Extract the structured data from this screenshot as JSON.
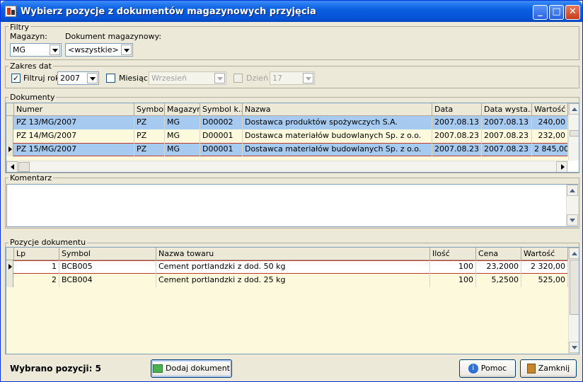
{
  "window": {
    "title": "Wybierz pozycje z dokumentów magazynowych przyjęcia"
  },
  "filters": {
    "group_label": "Filtry",
    "warehouse_label": "Magazyn:",
    "warehouse_value": "MG",
    "doc_label": "Dokument magazynowy:",
    "doc_value": "<wszystkie>"
  },
  "dates": {
    "group_label": "Zakres dat",
    "year_label": "Filtruj rok",
    "year_checked": "✓",
    "year_value": "2007",
    "month_label": "Miesiąc",
    "month_value": "Wrzesień",
    "day_label": "Dzień",
    "day_value": "17"
  },
  "documents": {
    "group_label": "Dokumenty",
    "columns": [
      "Numer",
      "Symbol",
      "Magazyn",
      "Symbol k...",
      "Nazwa",
      "Data",
      "Data wysta...",
      "Wartość"
    ],
    "rows": [
      [
        "PZ  13/MG/2007",
        "PZ",
        "MG",
        "D00002",
        "Dostawca produktów spożywczych S.A.",
        "2007.08.13",
        "2007.08.13",
        "240,00"
      ],
      [
        "PZ  14/MG/2007",
        "PZ",
        "MG",
        "D00001",
        "Dostawca materiałów budowlanych Sp. z o.o.",
        "2007.08.23",
        "2007.08.23",
        "232,00"
      ],
      [
        "PZ  15/MG/2007",
        "PZ",
        "MG",
        "D00001",
        "Dostawca materiałów budowlanych Sp. z o.o.",
        "2007.08.23",
        "2007.08.23",
        "2 845,00"
      ]
    ]
  },
  "comment": {
    "group_label": "Komentarz"
  },
  "positions": {
    "group_label": "Pozycje dokumentu",
    "columns": [
      "Lp",
      "Symbol",
      "Nazwa towaru",
      "Ilość",
      "Cena",
      "Wartość"
    ],
    "rows": [
      [
        "1",
        "BCB005",
        "Cement portlandzki z dod. 50 kg",
        "100",
        "23,2000",
        "2 320,00"
      ],
      [
        "2",
        "BCB004",
        "Cement portlandzki z dod. 25 kg",
        "100",
        "5,2500",
        "525,00"
      ]
    ]
  },
  "footer": {
    "selected_label": "Wybrano pozycji: 5",
    "add_button": "Dodaj dokument",
    "help_button": "Pomoc",
    "close_button": "Zamknij"
  },
  "colors": {
    "row_selected": "#a6caf0",
    "row_alt": "#fdf9dc",
    "title_bar": "#0a5fe0"
  }
}
